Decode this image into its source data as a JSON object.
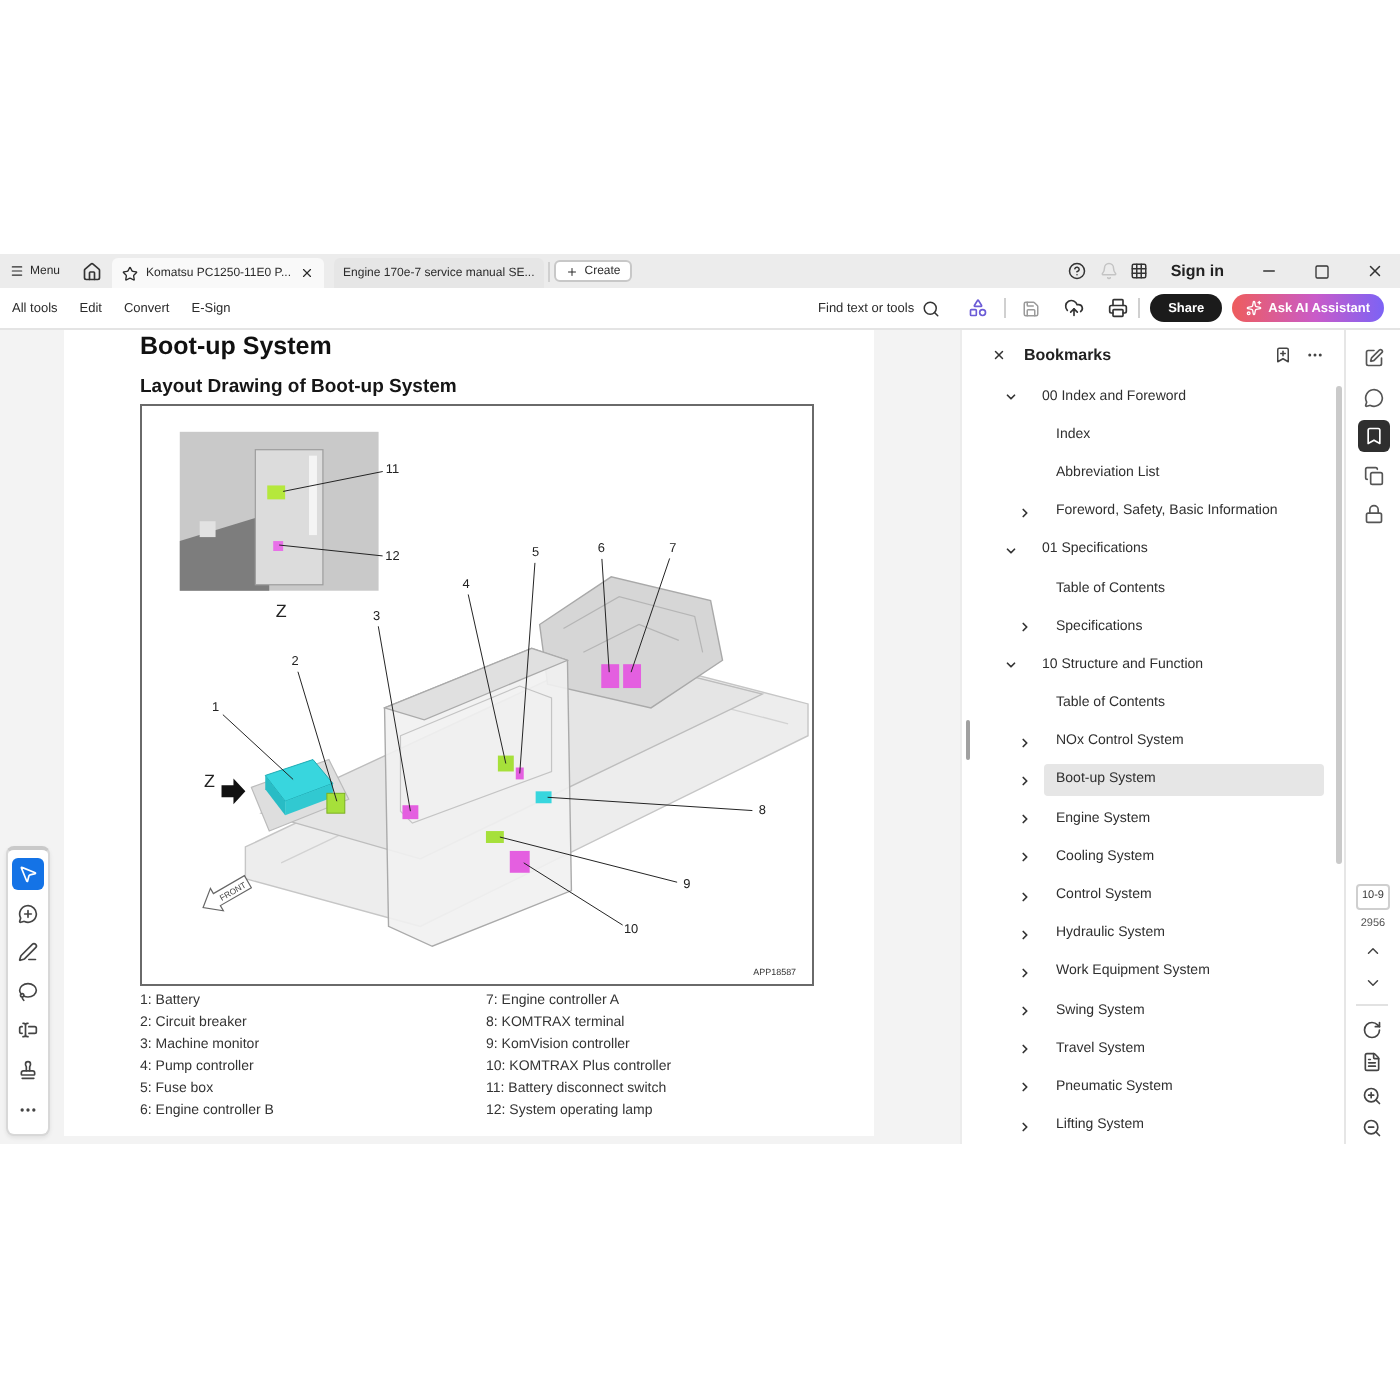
{
  "title_bar": {
    "menu": "Menu",
    "tabs": [
      {
        "label": "Komatsu PC1250-11E0 P...",
        "selected": true
      },
      {
        "label": "Engine 170e-7 service manual SE...",
        "selected": false
      }
    ],
    "create": "Create",
    "sign_in": "Sign in"
  },
  "menu_bar": {
    "items": [
      "All tools",
      "Edit",
      "Convert",
      "E-Sign"
    ],
    "find": "Find text or tools",
    "share": "Share",
    "ai_assistant": "Ask AI Assistant"
  },
  "left_toolbar": {
    "tools": [
      {
        "kind": "select",
        "selected": true
      },
      {
        "kind": "comment",
        "selected": false
      },
      {
        "kind": "draw",
        "selected": false
      },
      {
        "kind": "lasso",
        "selected": false
      },
      {
        "kind": "text",
        "selected": false
      },
      {
        "kind": "stamp",
        "selected": false
      },
      {
        "kind": "more",
        "selected": false
      }
    ]
  },
  "document": {
    "heading": "Boot-up System",
    "subheading": "Layout Drawing of Boot-up System",
    "figure": {
      "inset_view_label": "Z",
      "main_view_label": "Z",
      "front_sign": "FRONT",
      "code": "APP18587",
      "callouts": [
        "1",
        "2",
        "3",
        "4",
        "5",
        "6",
        "7",
        "8",
        "9",
        "10",
        "11",
        "12"
      ]
    },
    "legend": [
      "1: Battery",
      "2: Circuit breaker",
      "3: Machine monitor",
      "4: Pump controller",
      "5: Fuse box",
      "6: Engine controller B",
      "7: Engine controller A",
      "8: KOMTRAX terminal",
      "9: KomVision controller",
      "10: KOMTRAX Plus controller",
      "11: Battery disconnect switch",
      "12: System operating lamp"
    ]
  },
  "bookmarks": {
    "title": "Bookmarks",
    "items": [
      {
        "label": "00 Index and Foreword",
        "expanded": true,
        "selected": false,
        "children": [
          {
            "label": "Index",
            "selected": false
          },
          {
            "label": "Abbreviation List",
            "selected": false
          },
          {
            "label": "Foreword, Safety, Basic Information",
            "expanded": false,
            "selected": false
          }
        ]
      },
      {
        "label": "01 Specifications",
        "expanded": true,
        "selected": false,
        "children": [
          {
            "label": "Table of Contents",
            "selected": false
          },
          {
            "label": "Specifications",
            "expanded": false,
            "selected": false
          }
        ]
      },
      {
        "label": "10 Structure and Function",
        "expanded": true,
        "selected": false,
        "children": [
          {
            "label": "Table of Contents",
            "selected": false
          },
          {
            "label": "NOx Control System",
            "expanded": false,
            "selected": false
          },
          {
            "label": "Boot-up System",
            "expanded": false,
            "selected": true
          },
          {
            "label": "Engine System",
            "expanded": false,
            "selected": false
          },
          {
            "label": "Cooling System",
            "expanded": false,
            "selected": false
          },
          {
            "label": "Control System",
            "expanded": false,
            "selected": false
          },
          {
            "label": "Hydraulic System",
            "expanded": false,
            "selected": false
          },
          {
            "label": "Work Equipment System",
            "expanded": false,
            "selected": false
          },
          {
            "label": "Swing System",
            "expanded": false,
            "selected": false
          },
          {
            "label": "Travel System",
            "expanded": false,
            "selected": false
          },
          {
            "label": "Pneumatic System",
            "expanded": false,
            "selected": false
          },
          {
            "label": "Lifting System",
            "expanded": false,
            "selected": false
          }
        ]
      }
    ]
  },
  "right_rail": {
    "tools": [
      {
        "kind": "edit",
        "selected": false
      },
      {
        "kind": "comment",
        "selected": false
      },
      {
        "kind": "bookmarks",
        "selected": true
      },
      {
        "kind": "pages",
        "selected": false
      },
      {
        "kind": "protect",
        "selected": false
      }
    ],
    "page_label": "10-9",
    "page_count": "2956"
  }
}
